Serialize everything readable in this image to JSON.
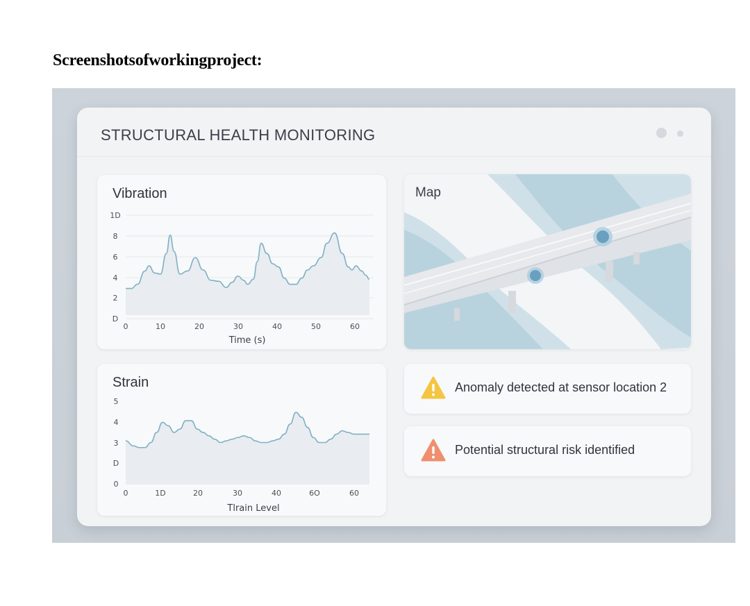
{
  "document": {
    "heading": "Screenshotsofworkingproject:"
  },
  "app": {
    "title": "STRUCTURAL HEALTH MONITORING"
  },
  "colors": {
    "line": "#7fb0c4",
    "warning": "#f5c542",
    "danger": "#ef8f6e",
    "water": "#b9d3de"
  },
  "vibration": {
    "title": "Vibration",
    "xlabel": "Time (s)",
    "x_ticks": [
      "0",
      "10",
      "20",
      "30",
      "40",
      "50",
      "60"
    ],
    "y_ticks": [
      "1D",
      "8",
      "6",
      "4",
      "2",
      "D"
    ]
  },
  "strain": {
    "title": "Strain",
    "xlabel": "Tlrain Level",
    "x_ticks": [
      "0",
      "1D",
      "20",
      "30",
      "40",
      "6O",
      "60"
    ],
    "y_ticks": [
      "5",
      "4",
      "3",
      "D",
      "0"
    ]
  },
  "map": {
    "title": "Map",
    "sensors": [
      "sensor-1",
      "sensor-2"
    ]
  },
  "alerts": [
    {
      "icon": "warning-triangle-icon",
      "text": "Anomaly detected at sensor location 2"
    },
    {
      "icon": "risk-triangle-icon",
      "text": "Potential structural risk identified"
    }
  ],
  "chart_data": [
    {
      "type": "line",
      "title": "Vibration",
      "xlabel": "Time (s)",
      "ylabel": "",
      "xlim": [
        0,
        63
      ],
      "ylim": [
        0,
        10
      ],
      "x": [
        0,
        1.5,
        3,
        5,
        6,
        7.5,
        9,
        10.5,
        11.5,
        12.5,
        14,
        16,
        18,
        20,
        22,
        24,
        26,
        27.5,
        29,
        30.5,
        31.5,
        33,
        34,
        35,
        36.5,
        38,
        39.5,
        41,
        42.5,
        44,
        45.5,
        47,
        48.5,
        50.5,
        52,
        54,
        56,
        57.5,
        58.5,
        59.5,
        61,
        62,
        63
      ],
      "series": [
        {
          "values": [
            2.6,
            2.6,
            3.0,
            4.3,
            4.8,
            4.1,
            4.0,
            6.0,
            7.8,
            6.2,
            4.0,
            4.3,
            5.6,
            4.4,
            3.4,
            3.3,
            2.7,
            3.2,
            3.8,
            3.4,
            3.0,
            3.5,
            5.2,
            7.0,
            6.0,
            5.0,
            4.7,
            3.6,
            3.0,
            3.0,
            3.6,
            4.4,
            4.8,
            5.6,
            7.0,
            8.0,
            6.0,
            4.7,
            4.4,
            4.8,
            4.3,
            3.9,
            3.5
          ]
        }
      ]
    },
    {
      "type": "line",
      "title": "Strain",
      "xlabel": "Tlrain Level",
      "ylabel": "",
      "xlim": [
        0,
        63
      ],
      "ylim": [
        0,
        5
      ],
      "x": [
        0,
        2,
        3.5,
        5,
        6.5,
        8,
        9.5,
        11,
        12.5,
        14,
        15.5,
        17,
        18.5,
        20,
        21.5,
        23,
        24.5,
        26,
        27.5,
        29,
        30.5,
        32,
        33.5,
        35,
        36.5,
        38,
        39.5,
        41,
        42.5,
        44,
        45.5,
        47,
        48.5,
        50,
        51.5,
        53,
        54.5,
        56,
        57.5,
        59,
        60.5,
        62,
        63
      ],
      "series": [
        {
          "values": [
            2.6,
            2.3,
            2.2,
            2.2,
            2.5,
            3.1,
            3.7,
            3.5,
            3.1,
            3.3,
            3.8,
            3.8,
            3.3,
            3.1,
            2.9,
            2.7,
            2.5,
            2.6,
            2.7,
            2.8,
            2.9,
            2.8,
            2.6,
            2.5,
            2.5,
            2.6,
            2.7,
            3.0,
            3.6,
            4.3,
            4.0,
            3.4,
            2.8,
            2.5,
            2.5,
            2.7,
            3.0,
            3.2,
            3.1,
            3.0,
            3.0,
            3.0,
            3.0
          ]
        }
      ]
    }
  ]
}
